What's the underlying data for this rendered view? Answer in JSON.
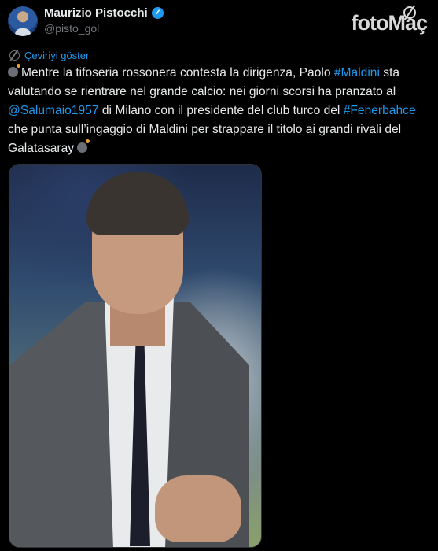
{
  "author": {
    "name": "Maurizio Pistocchi",
    "handle": "@pisto_gol",
    "verified_badge": "✓"
  },
  "watermark": {
    "foto": "foto",
    "mac": "Maç"
  },
  "translate_label": "Çeviriyi göster",
  "tweet": {
    "p1": "Mentre la tifoseria rossonera contesta la dirigenza, Paolo ",
    "hashtag_maldini": "#Maldini",
    "p2": " sta valutando se rientrare nel grande calcio: nei giorni scorsi ha pranzato al ",
    "mention_salumaio": "@Salumaio1957",
    "p3": " di Milano con il presidente del club turco del ",
    "hashtag_fenerbahce": "#Fenerbahce",
    "p4": " che punta sull’ingaggio di Maldini per strappare il titolo ai grandi rivali del Galatasaray"
  },
  "colors": {
    "background": "#000000",
    "text": "#e7e9ea",
    "muted": "#71767b",
    "link": "#1d9bf0"
  },
  "icons": [
    "avatar",
    "verified-badge-icon",
    "translate-icon",
    "bomb-emoji-icon",
    "fotomac-logo"
  ]
}
